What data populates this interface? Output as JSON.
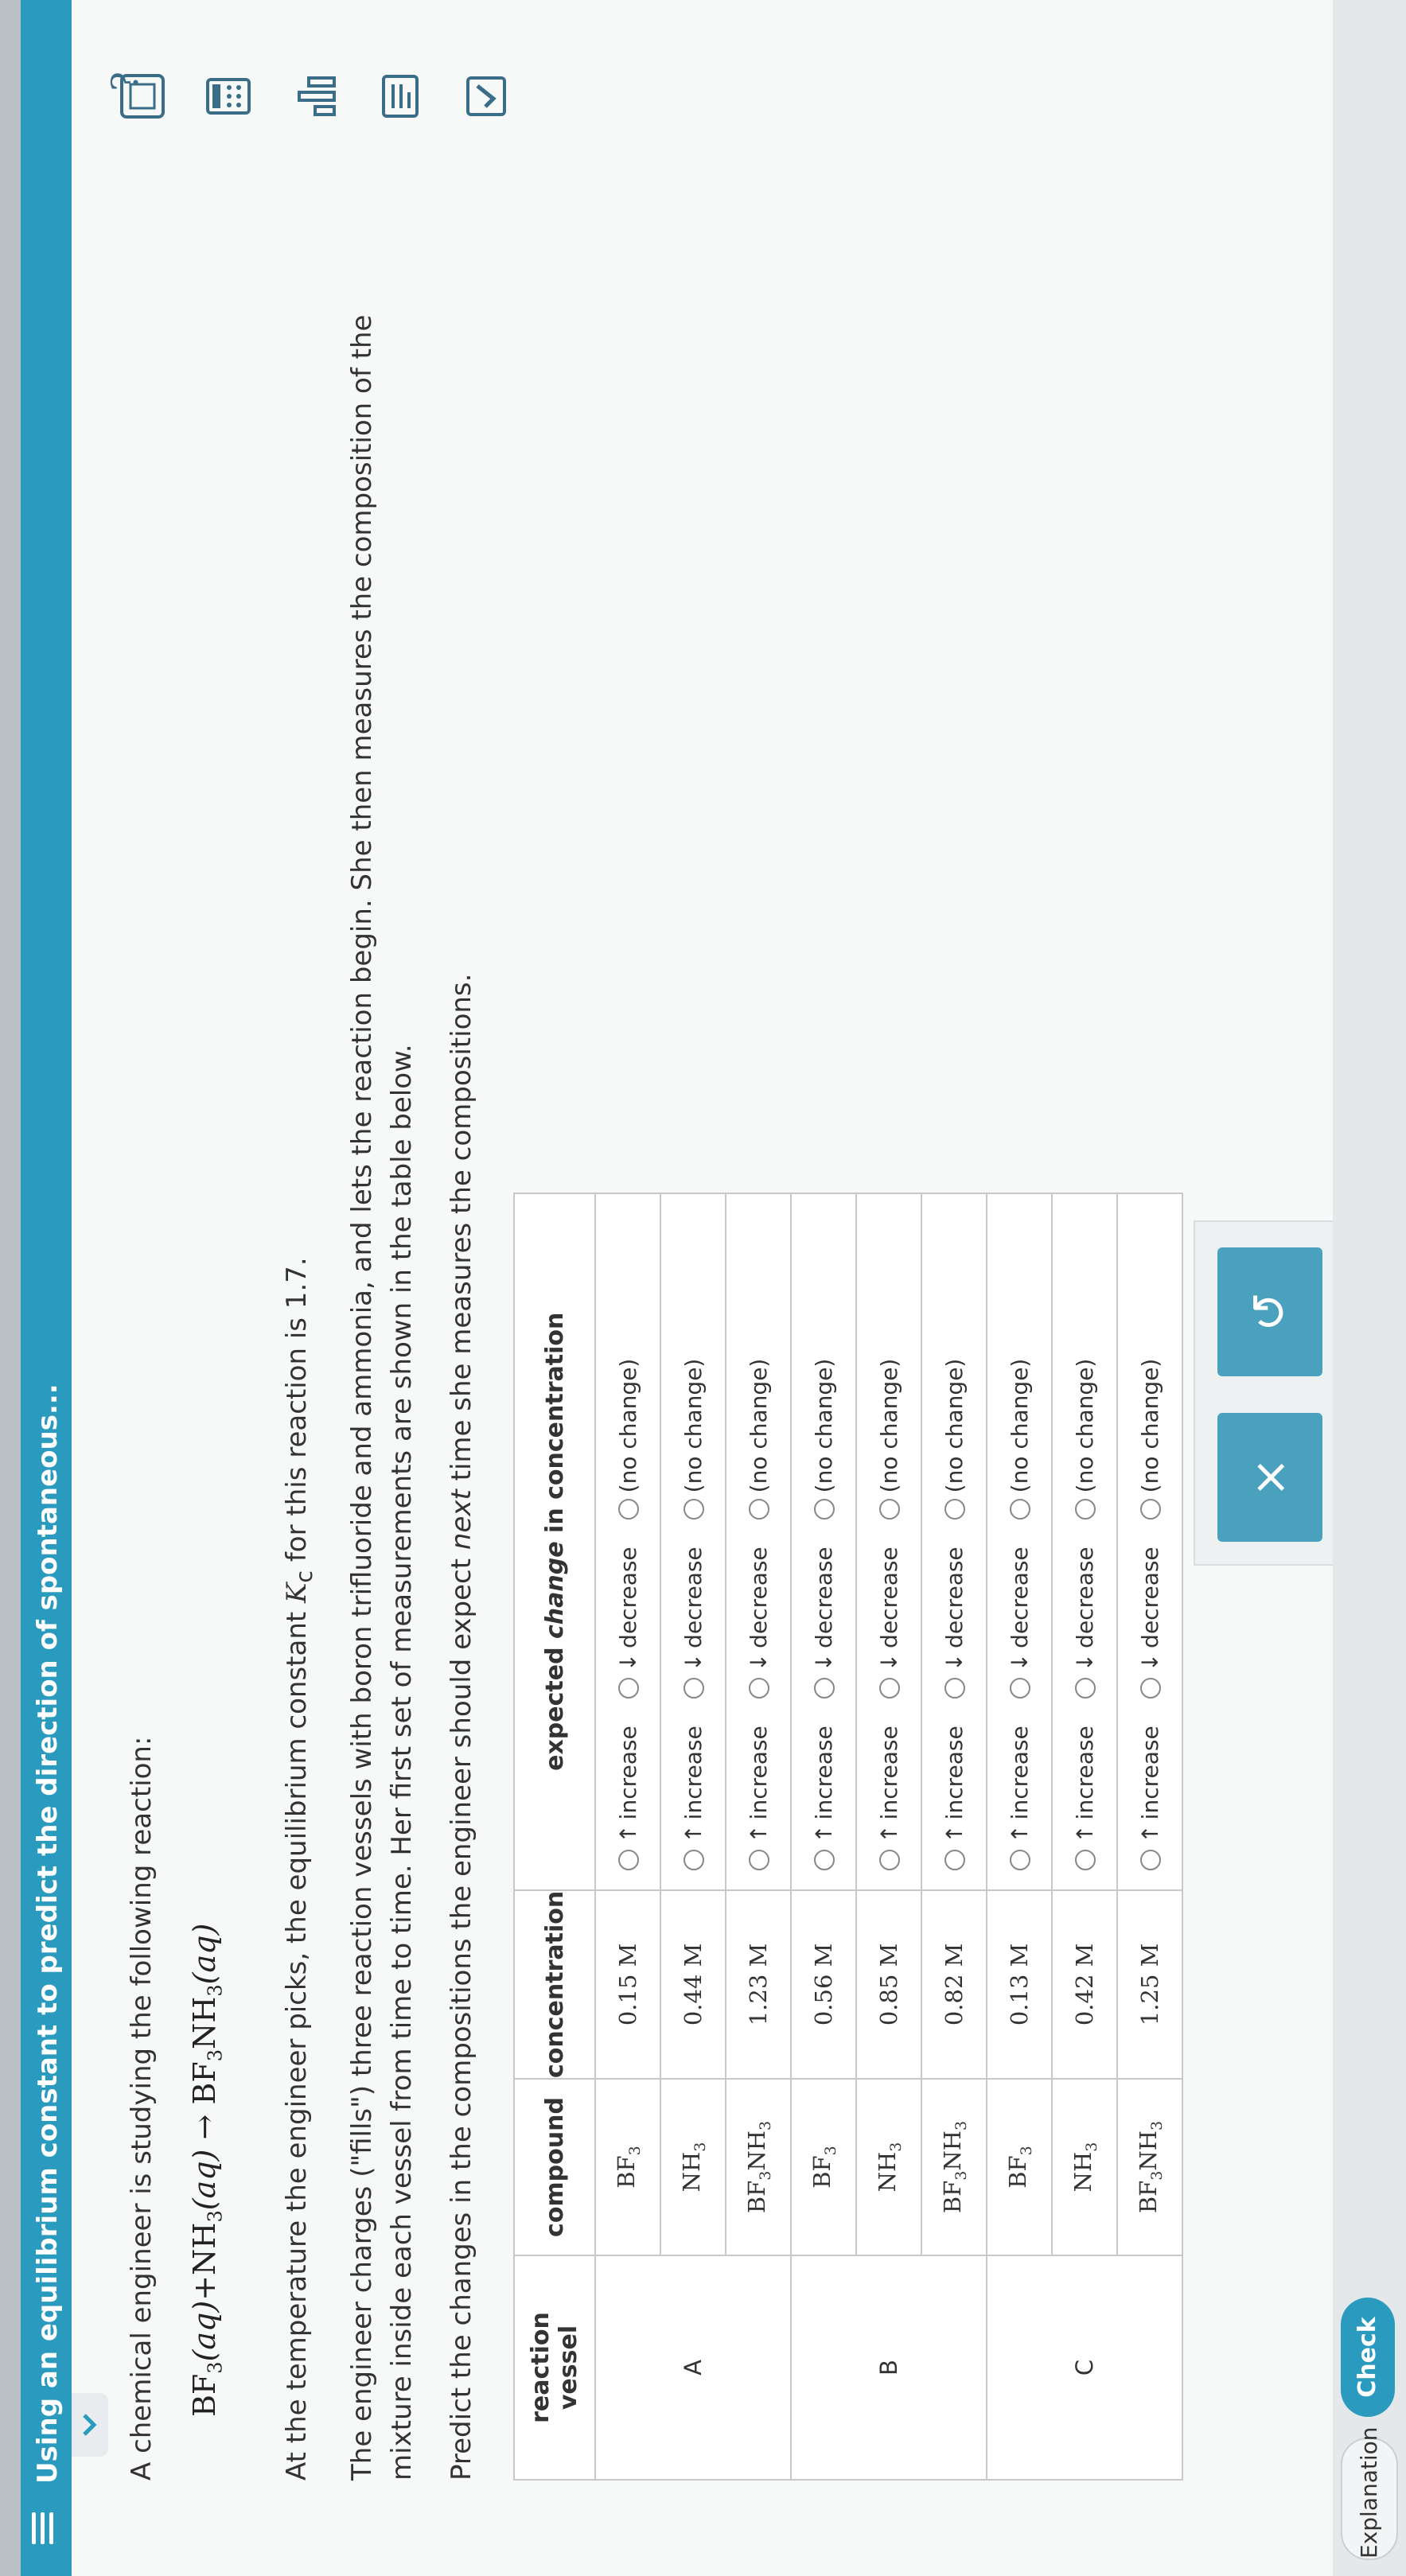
{
  "header": {
    "title": "Using an equilibrium constant to predict the direction of spontaneous..."
  },
  "question": {
    "intro": "A chemical engineer is studying the following reaction:",
    "equation": {
      "r1": "BF",
      "r1_sub": "3",
      "r1_state": "(aq)",
      "plus": "+",
      "r2": "NH",
      "r2_sub": "3",
      "r2_state": "(aq)",
      "arrow": "→",
      "p1a": "BF",
      "p1a_sub": "3",
      "p1b": "NH",
      "p1b_sub": "3",
      "p1_state": "(aq)"
    },
    "kc_pre": "At the temperature the engineer picks, the equilibrium constant ",
    "kc_symbol": "K",
    "kc_sub": "c",
    "kc_post": " for this reaction is 1.7.",
    "charge_line1": "The engineer charges (\"fills\") three reaction vessels with boron trifluoride and ammonia, and lets the reaction begin. She then measures the composition of the",
    "charge_line2": "mixture inside each vessel from time to time. Her first set of measurements are shown in the table below.",
    "predict_pre": "Predict the changes in the compositions the engineer should expect ",
    "predict_em": "next",
    "predict_post": " time she measures the compositions."
  },
  "table": {
    "headers": {
      "vessel_l1": "reaction",
      "vessel_l2": "vessel",
      "compound": "compound",
      "concentration": "concentration",
      "expected_pre": "expected ",
      "expected_em": "change",
      "expected_post": " in concentration"
    },
    "options": {
      "increase": "increase",
      "decrease": "decrease",
      "nochange": "(no change)",
      "up": "↑",
      "down": "↓"
    },
    "vessels": [
      {
        "name": "A",
        "rows": [
          {
            "c1": "BF",
            "s1": "3",
            "c2": "",
            "s2": "",
            "conc": "0.15 M"
          },
          {
            "c1": "NH",
            "s1": "3",
            "c2": "",
            "s2": "",
            "conc": "0.44 M"
          },
          {
            "c1": "BF",
            "s1": "3",
            "c2": "NH",
            "s2": "3",
            "conc": "1.23 M"
          }
        ]
      },
      {
        "name": "B",
        "rows": [
          {
            "c1": "BF",
            "s1": "3",
            "c2": "",
            "s2": "",
            "conc": "0.56 M"
          },
          {
            "c1": "NH",
            "s1": "3",
            "c2": "",
            "s2": "",
            "conc": "0.85 M"
          },
          {
            "c1": "BF",
            "s1": "3",
            "c2": "NH",
            "s2": "3",
            "conc": "0.82 M"
          }
        ]
      },
      {
        "name": "C",
        "rows": [
          {
            "c1": "BF",
            "s1": "3",
            "c2": "",
            "s2": "",
            "conc": "0.13 M"
          },
          {
            "c1": "NH",
            "s1": "3",
            "c2": "",
            "s2": "",
            "conc": "0.42 M"
          },
          {
            "c1": "BF",
            "s1": "3",
            "c2": "NH",
            "s2": "3",
            "conc": "1.25 M"
          }
        ]
      }
    ]
  },
  "actions": {
    "clear": "×",
    "undo": "↺"
  },
  "footer": {
    "explanation": "Explanation",
    "check": "Check"
  },
  "help": "?",
  "colors": {
    "accent": "#2a9bbf",
    "button": "#4aa1bd"
  },
  "icons": [
    "menu-icon",
    "chevron-icon",
    "periodic-table-icon",
    "calculator-icon",
    "bar-chart-icon",
    "data-icon",
    "checkmark-box-icon",
    "help-icon"
  ]
}
